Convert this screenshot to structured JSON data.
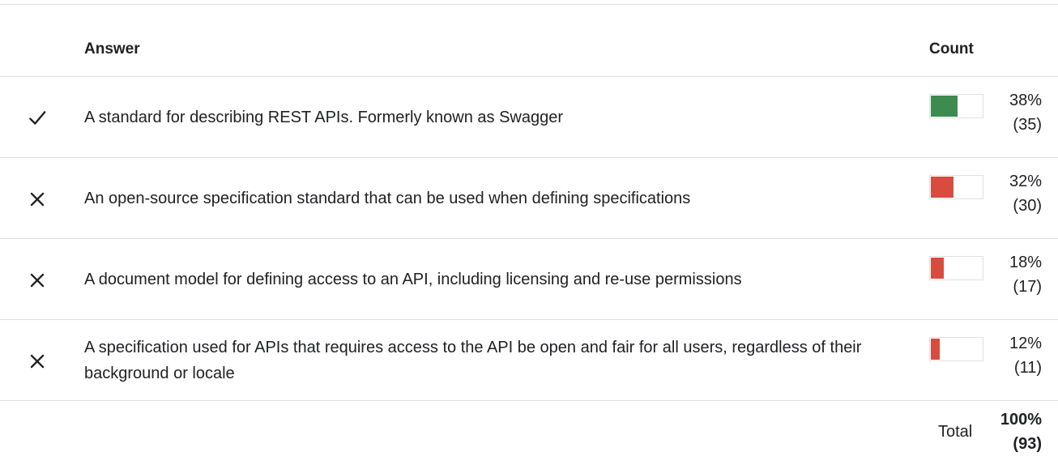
{
  "table": {
    "header": {
      "answer": "Answer",
      "count": "Count"
    },
    "rows": [
      {
        "correct": true,
        "mark_icon": "check-icon",
        "text": "A standard for describing REST APIs. Formerly known as Swagger",
        "percent": "38%",
        "count": "(35)",
        "fraction": 0.38,
        "bar_color": "#3d8b4f"
      },
      {
        "correct": false,
        "mark_icon": "close-icon",
        "text": "An open-source specification standard that can be used when defining specifications",
        "percent": "32%",
        "count": "(30)",
        "fraction": 0.32,
        "bar_color": "#d84c3f"
      },
      {
        "correct": false,
        "mark_icon": "close-icon",
        "text": "A document model for defining access to an API, including licensing and re-use permissions",
        "percent": "18%",
        "count": "(17)",
        "fraction": 0.18,
        "bar_color": "#d84c3f"
      },
      {
        "correct": false,
        "mark_icon": "close-icon",
        "text": "A specification used for APIs that requires access to the API be open and fair for all users, regardless of their background or locale",
        "percent": "12%",
        "count": "(11)",
        "fraction": 0.12,
        "bar_color": "#d84c3f"
      }
    ],
    "total": {
      "label": "Total",
      "percent": "100%",
      "count": "(93)"
    }
  }
}
